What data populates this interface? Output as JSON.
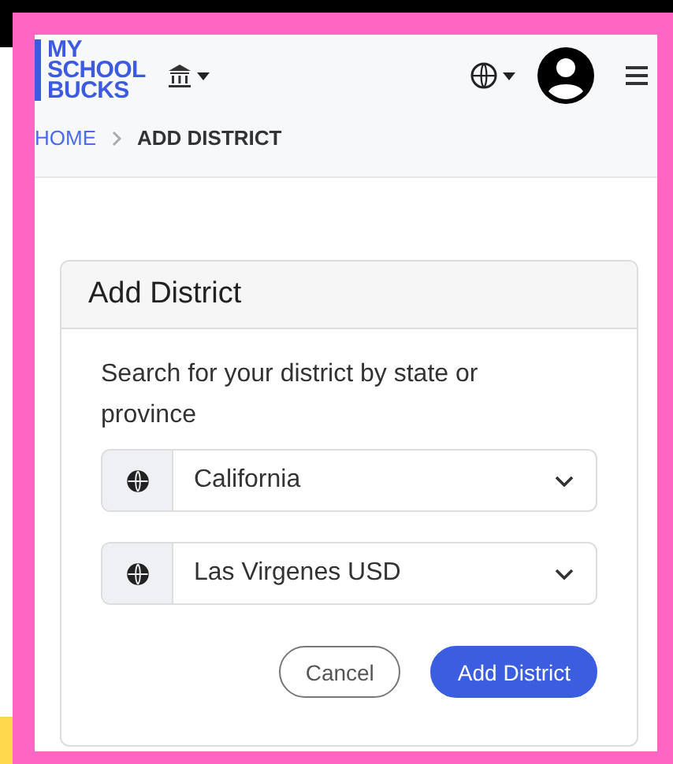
{
  "header": {
    "logo_lines": [
      "MY",
      "SCHOOL",
      "BUCKS"
    ]
  },
  "breadcrumb": [
    {
      "label": "HOME",
      "selected": false
    },
    {
      "label": "ADD DISTRICT",
      "selected": true
    }
  ],
  "card": {
    "title": "Add District",
    "prompt": "Search for your district by state or province",
    "selects": [
      {
        "value": "California"
      },
      {
        "value": "Las Virgenes USD"
      }
    ],
    "buttons": [
      {
        "label": "Cancel",
        "kind": "secondary"
      },
      {
        "label": "Add District",
        "kind": "primary"
      }
    ]
  }
}
